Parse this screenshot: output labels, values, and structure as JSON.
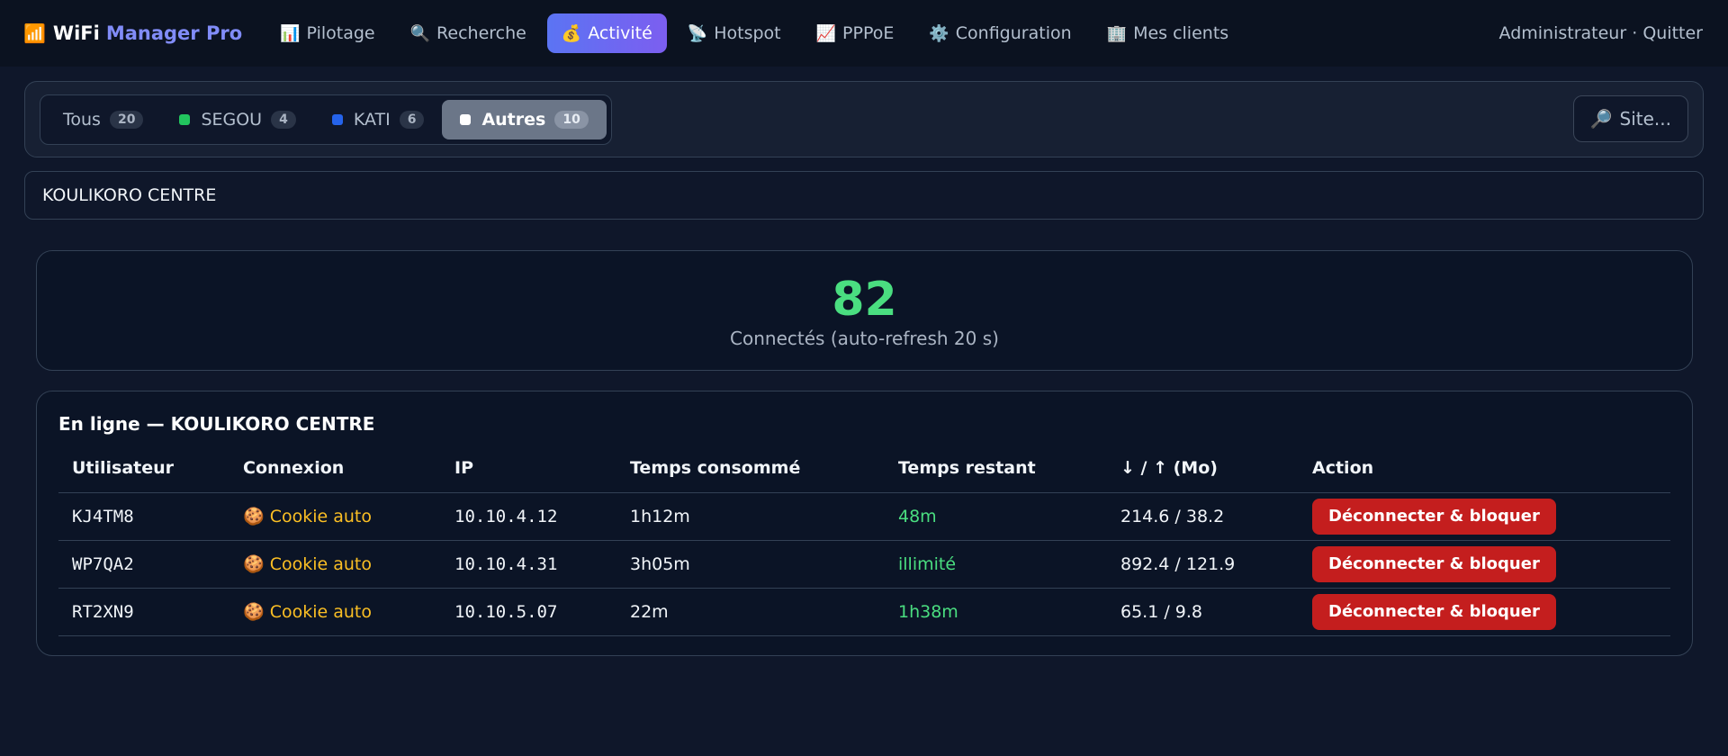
{
  "brand": {
    "icon": "📶",
    "name": "WiFi",
    "accent": "Manager Pro"
  },
  "nav": {
    "items": [
      {
        "icon": "📊",
        "label": "Pilotage"
      },
      {
        "icon": "🔍",
        "label": "Recherche"
      },
      {
        "icon": "💰",
        "label": "Activité",
        "active": true
      },
      {
        "icon": "📡",
        "label": "Hotspot"
      },
      {
        "icon": "📈",
        "label": "PPPoE"
      },
      {
        "icon": "⚙️",
        "label": "Configuration"
      },
      {
        "icon": "🏢",
        "label": "Mes clients"
      }
    ],
    "user": "Administrateur",
    "separator": "·",
    "logout": "Quitter"
  },
  "filters": {
    "tabs": [
      {
        "label": "Tous",
        "count": "20",
        "color": ""
      },
      {
        "label": "SEGOU",
        "count": "4",
        "color": "#22c55e"
      },
      {
        "label": "KATI",
        "count": "6",
        "color": "#2563eb"
      },
      {
        "label": "Autres",
        "count": "10",
        "color": "#ffffff",
        "active": true
      }
    ],
    "site_button": {
      "icon": "🔎",
      "label": "Site..."
    }
  },
  "site_name": "KOULIKORO CENTRE",
  "stats": {
    "connected": "82",
    "label": "Connectés (auto-refresh 20 s)"
  },
  "online": {
    "title": "En ligne — KOULIKORO CENTRE",
    "columns": [
      "Utilisateur",
      "Connexion",
      "IP",
      "Temps consommé",
      "Temps restant",
      "↓ / ↑ (Mo)",
      "Action"
    ],
    "rows": [
      {
        "user": "KJ4TM8",
        "connection": "🍪 Cookie auto",
        "ip": "10.10.4.12",
        "used": "1h12m",
        "remaining": "48m",
        "traffic": "214.6 / 38.2",
        "action": "Déconnecter & bloquer"
      },
      {
        "user": "WP7QA2",
        "connection": "🍪 Cookie auto",
        "ip": "10.10.4.31",
        "used": "3h05m",
        "remaining": "illimité",
        "traffic": "892.4 / 121.9",
        "action": "Déconnecter & bloquer"
      },
      {
        "user": "RT2XN9",
        "connection": "🍪 Cookie auto",
        "ip": "10.10.5.07",
        "used": "22m",
        "remaining": "1h38m",
        "traffic": "65.1 / 9.8",
        "action": "Déconnecter & bloquer"
      }
    ]
  },
  "colors": {
    "accent": "#5b74f3",
    "success": "#4ade80",
    "warning": "#fbbf24",
    "danger": "#c41e1e"
  }
}
